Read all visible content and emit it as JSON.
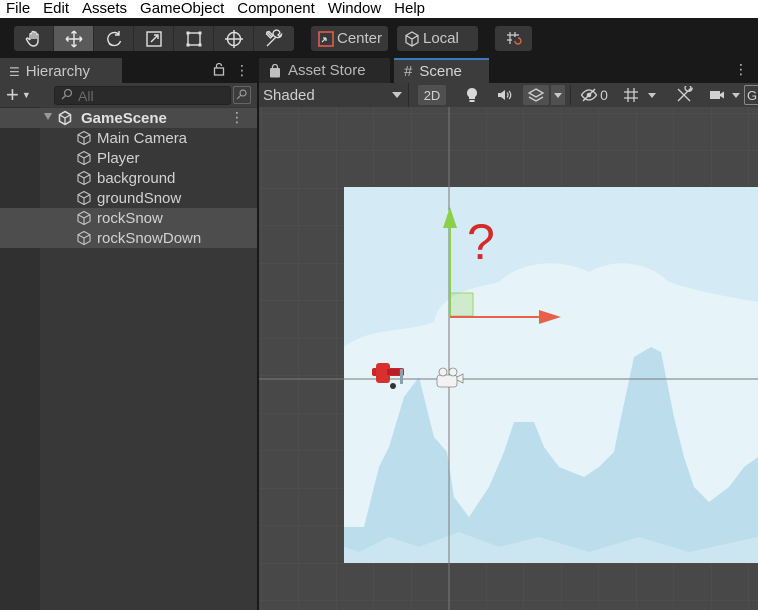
{
  "menubar": {
    "items": [
      "File",
      "Edit",
      "Assets",
      "GameObject",
      "Component",
      "Window",
      "Help"
    ]
  },
  "toolbar": {
    "tools": [
      "hand-tool",
      "move-tool",
      "rotate-tool",
      "scale-tool",
      "rect-tool",
      "transform-tool",
      "custom-editor-tool"
    ],
    "active_tool": "move-tool",
    "pivot_label": "Center",
    "rotation_label": "Local"
  },
  "hierarchy": {
    "tab_label": "Hierarchy",
    "search_placeholder": "All",
    "scene_name": "GameScene",
    "objects": [
      "Main Camera",
      "Player",
      "background",
      "groundSnow",
      "rockSnow",
      "rockSnowDown"
    ],
    "selected_objects": [
      "rockSnow",
      "rockSnowDown"
    ]
  },
  "scene_panel": {
    "tabs": [
      "Asset Store",
      "Scene"
    ],
    "active_tab": "Scene",
    "draw_mode": "Shaded",
    "mode_2d_label": "2D",
    "hidden_count": "0",
    "gizmos_label": "G",
    "question_mark": "?"
  },
  "colors": {
    "accent_tab": "#3a79bb",
    "sky": "#d4eaf4",
    "gizmo_x": "#e8604c",
    "gizmo_y": "#8ad04a",
    "question": "#d42a2a"
  }
}
